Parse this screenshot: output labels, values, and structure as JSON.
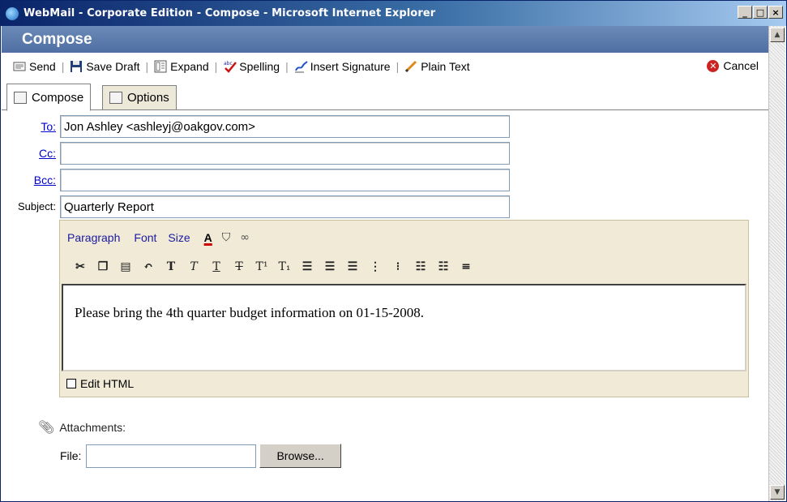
{
  "window": {
    "title": "WebMail - Corporate Edition - Compose - Microsoft Internet Explorer",
    "minimize": "_",
    "maximize": "□",
    "close": "×"
  },
  "header": {
    "title": "Compose"
  },
  "toolbar": {
    "send": "Send",
    "save_draft": "Save Draft",
    "expand": "Expand",
    "spelling": "Spelling",
    "insert_signature": "Insert Signature",
    "plain_text": "Plain Text",
    "cancel": "Cancel",
    "separator": "|"
  },
  "tabs": [
    {
      "label": "Compose",
      "active": true
    },
    {
      "label": "Options",
      "active": false
    }
  ],
  "fields": {
    "to_label": "To:",
    "to_value": "Jon Ashley <ashleyj@oakgov.com>",
    "cc_label": "Cc:",
    "cc_value": "",
    "bcc_label": "Bcc:",
    "bcc_value": "",
    "subject_label": "Subject:",
    "subject_value": "Quarterly Report"
  },
  "editor": {
    "menu": {
      "paragraph": "Paragraph",
      "font": "Font",
      "size": "Size"
    },
    "body": "Please bring the 4th quarter budget information on 01-15-2008.",
    "edit_html_label": "Edit HTML"
  },
  "attachments": {
    "label": "Attachments:",
    "file_label": "File:",
    "browse_label": "Browse..."
  },
  "colors": {
    "header_blue": "#4f6fa3",
    "link_blue": "#0000cc",
    "editor_bg": "#f0ead7",
    "cancel_red": "#cc2222"
  }
}
